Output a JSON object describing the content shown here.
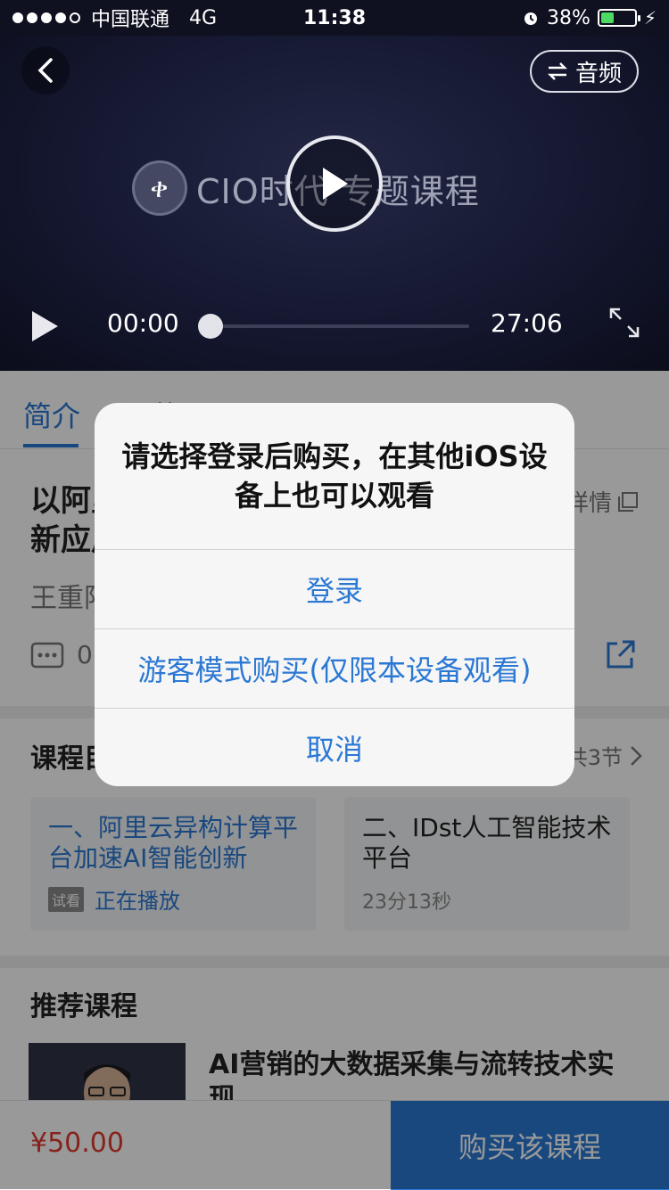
{
  "status_bar": {
    "carrier": "中国联通",
    "network": "4G",
    "time": "11:38",
    "battery": "38%"
  },
  "video": {
    "audio_label": "音频",
    "title_text": "CIO时代 专题课程",
    "logo_glyph": "ቀ",
    "current_time": "00:00",
    "duration": "27:06"
  },
  "tabs": [
    {
      "label": "简介"
    },
    {
      "label": "课件"
    }
  ],
  "course": {
    "title": "以阿里云异构计算平台加速AI智能创新应用",
    "detail_label": "详情",
    "author": "王重阳",
    "comment_count": "0"
  },
  "lessons": {
    "section_title": "课程目录",
    "count_text": "共3节",
    "items": [
      {
        "title": "一、阿里云异构计算平台加速AI智能创新",
        "badge": "试看",
        "status": "正在播放"
      },
      {
        "title": "二、IDst人工智能技术平台",
        "duration": "23分13秒"
      }
    ]
  },
  "recommend": {
    "section_title": "推荐课程",
    "items": [
      {
        "title": "AI营销的大数据采集与流转技术实现"
      }
    ]
  },
  "purchase": {
    "price": "¥50.00",
    "buy_label": "购买该课程"
  },
  "alert": {
    "message": "请选择登录后购买，在其他iOS设备上也可以观看",
    "buttons": [
      {
        "label": "登录"
      },
      {
        "label": "游客模式购买(仅限本设备观看)"
      },
      {
        "label": "取消"
      }
    ]
  },
  "colors": {
    "accent": "#2b78d4",
    "price": "#e23a2e",
    "battery": "#4cd964"
  }
}
